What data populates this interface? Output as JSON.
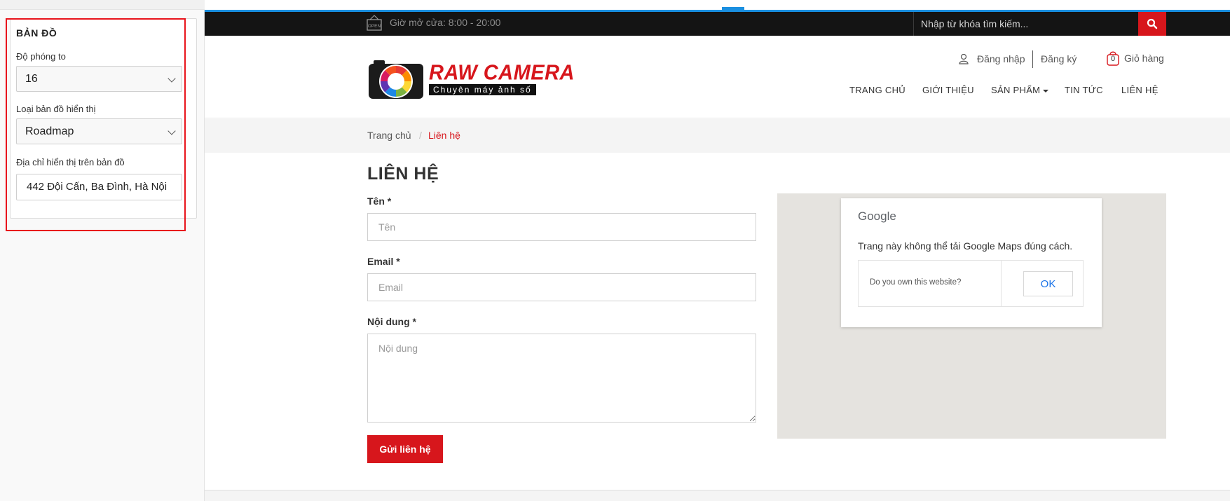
{
  "sidebar": {
    "section_title": "BẢN ĐỒ",
    "zoom": {
      "label": "Độ phóng to",
      "value": "16"
    },
    "map_type": {
      "label": "Loại bản đồ hiển thị",
      "value": "Roadmap"
    },
    "address": {
      "label": "Địa chỉ hiển thị trên bản đồ",
      "value": "442 Đội Cấn, Ba Đình, Hà Nội"
    }
  },
  "topbar": {
    "hours": "Giờ mở cửa: 8:00 - 20:00",
    "search_placeholder": "Nhập từ khóa tìm kiếm..."
  },
  "header": {
    "logo_text": "RAW CAMERA",
    "logo_tagline": "Chuyên máy ảnh số",
    "login": "Đăng nhập",
    "register": "Đăng ký",
    "cart_count": "0",
    "cart_label": "Giỏ hàng",
    "nav": [
      "TRANG CHỦ",
      "GIỚI THIỆU",
      "SẢN PHẨM",
      "TIN TỨC",
      "LIÊN HỆ"
    ]
  },
  "breadcrumb": {
    "home": "Trang chủ",
    "separator": "/",
    "current": "Liên hệ"
  },
  "contact": {
    "title": "LIÊN HỆ",
    "name_label": "Tên *",
    "name_placeholder": "Tên",
    "email_label": "Email *",
    "email_placeholder": "Email",
    "content_label": "Nội dung *",
    "content_placeholder": "Nội dung",
    "submit": "Gửi liên hệ"
  },
  "map": {
    "brand": "Google",
    "message": "Trang này không thể tải Google Maps đúng cách.",
    "own_question": "Do you own this website?",
    "ok": "OK"
  },
  "colors": {
    "accent_red": "#d7161c",
    "highlight_red": "#e8141c",
    "topbar_black": "#141414",
    "link_blue": "#1a73e8"
  }
}
